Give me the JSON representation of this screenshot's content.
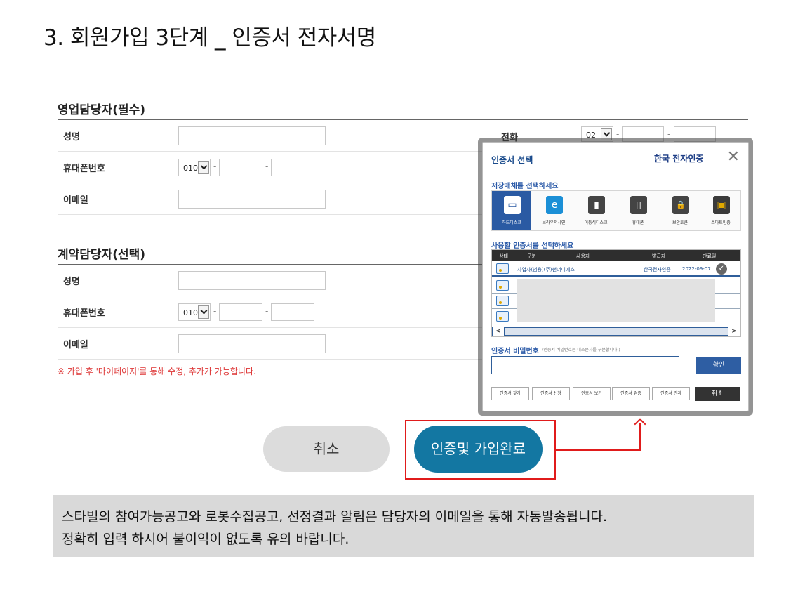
{
  "page": {
    "title": "3. 회원가입 3단계 _ 인증서 전자서명"
  },
  "sales_contact": {
    "title": "영업담당자(필수)",
    "rows": {
      "name": "성명",
      "mobile": "휴대폰번호",
      "email": "이메일"
    },
    "mobile_prefix": "010",
    "tel_label": "전화",
    "tel_prefix": "02"
  },
  "contract_contact": {
    "title": "계약담당자(선택)",
    "rows": {
      "name": "성명",
      "mobile": "휴대폰번호",
      "email": "이메일"
    },
    "mobile_prefix": "010"
  },
  "dash": "-",
  "note": "※ 가입 후 '마이페이지'를 통해 수정, 추가가 가능합니다.",
  "modal": {
    "title": "인증서 선택",
    "logo": "한국 전자인증",
    "close": "✕",
    "media_title": "저장매체를 선택하세요",
    "media": [
      {
        "label": "하드디스크",
        "icon": "monitor-icon",
        "glyph": "▭"
      },
      {
        "label": "브라우저사인",
        "icon": "ie-browser-icon",
        "glyph": "e"
      },
      {
        "label": "이동식디스크",
        "icon": "usb-drive-icon",
        "glyph": "▮"
      },
      {
        "label": "휴대폰",
        "icon": "phone-icon",
        "glyph": "▯"
      },
      {
        "label": "보안토큰",
        "icon": "security-token-icon",
        "glyph": "🔒"
      },
      {
        "label": "스마트인증",
        "icon": "smart-auth-icon",
        "glyph": "▣"
      }
    ],
    "cert_title": "사용할 인증서를 선택하세요",
    "columns": {
      "status": "상태",
      "type": "구분",
      "user": "사용자",
      "issuer": "발급자",
      "expiry": "만료일"
    },
    "cert": {
      "user": "사업자(범용)(주)썬더디에스",
      "issuer": "한국전자인증",
      "expiry": "2022-09-07"
    },
    "scroll_left": "<",
    "scroll_right": ">",
    "pw_label": "인증서 비밀번호",
    "pw_hint": "(인증서 비밀번호는 대소문자를 구분합니다.)",
    "confirm": "확인",
    "footer_buttons": [
      "인증서 찾기",
      "인증서 신청",
      "인증서 보기",
      "인증서 검증",
      "인증서 관리"
    ],
    "cancel": "취소"
  },
  "buttons": {
    "cancel": "취소",
    "complete": "인증및 가입완료"
  },
  "notice": {
    "line1": "스타빌의  참여가능공고와  로봇수집공고,  선정결과 알림은   담당자의  이메일을 통해  자동발송됩니다.",
    "line2": "정확히 입력 하시어 불이익이 없도록  유의 바랍니다."
  },
  "colors": {
    "accent": "#1377a2",
    "highlight": "#e01b1b",
    "modal_blue": "#2e5ea3"
  }
}
